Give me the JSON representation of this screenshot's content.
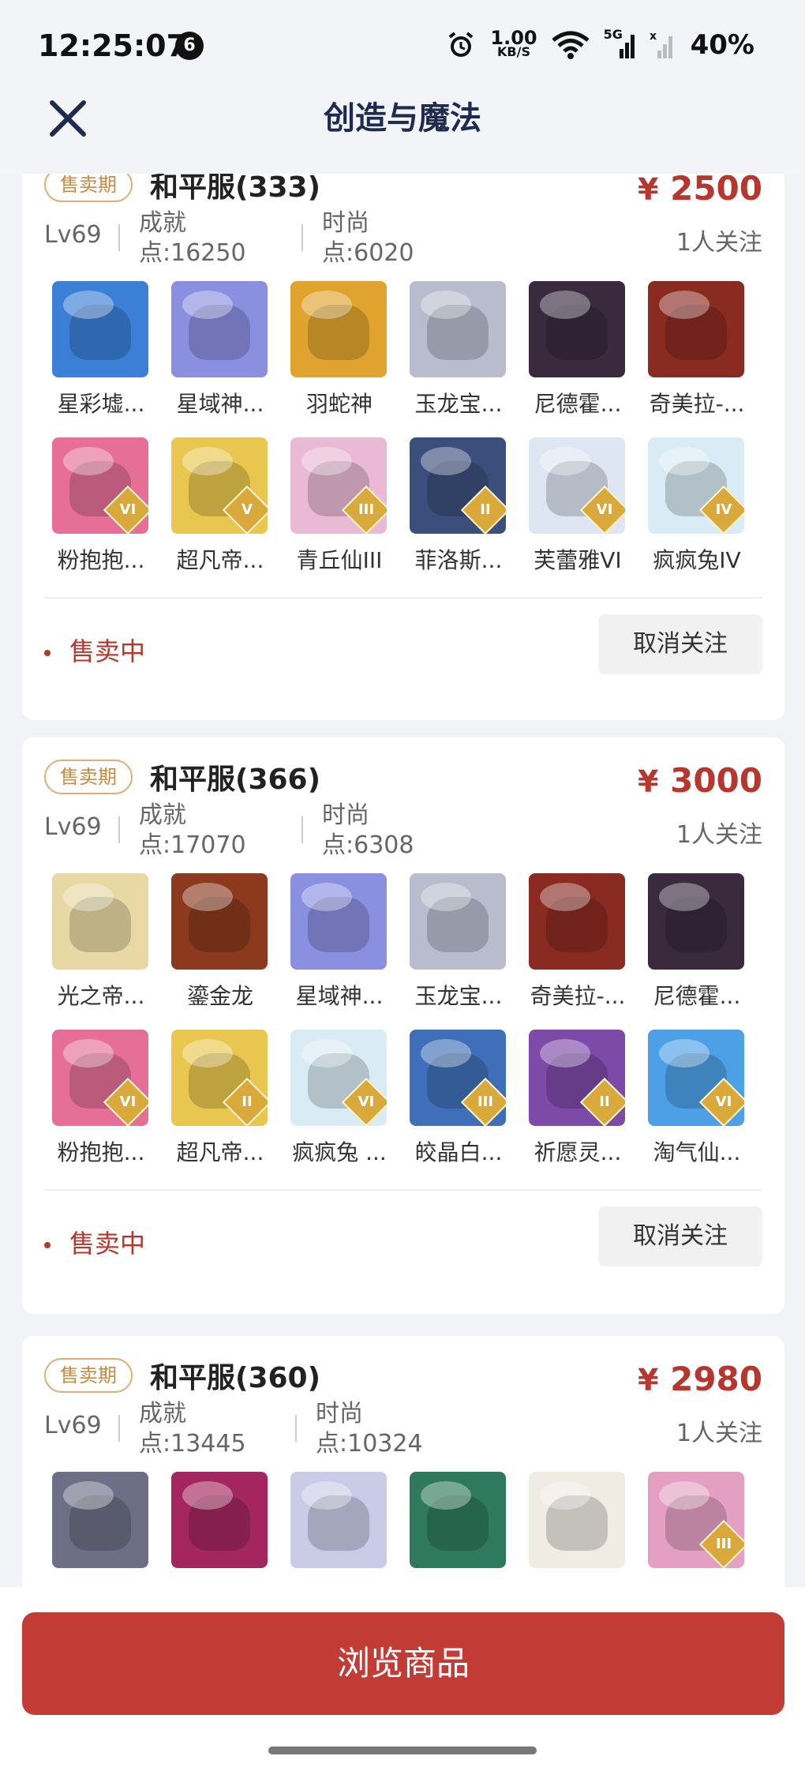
{
  "status_bar": {
    "time": "12:25:07",
    "notification_count": "6",
    "speed_value": "1.00",
    "speed_unit": "KB/S",
    "network": "5G",
    "battery": "40%"
  },
  "nav": {
    "title": "创造与魔法"
  },
  "cards": [
    {
      "tag": "售卖期",
      "server": "和平服(333)",
      "price_symbol": "¥",
      "price": "2500",
      "followers": "1人关注",
      "level": "Lv69",
      "achievement": [
        "成就",
        "点:16250"
      ],
      "fashion": [
        "时尚",
        "点:6020"
      ],
      "items": [
        {
          "name": "星彩墟...",
          "color": "#3b7fd6"
        },
        {
          "name": "星域神...",
          "color": "#8a8fe0"
        },
        {
          "name": "羽蛇神",
          "color": "#e0a42e"
        },
        {
          "name": "玉龙宝...",
          "color": "#b9bccd"
        },
        {
          "name": "尼德霍...",
          "color": "#3a2a3e"
        },
        {
          "name": "奇美拉-...",
          "color": "#8a2b22"
        },
        {
          "name": "粉抱抱...",
          "color": "#e56f97",
          "rank": "VI"
        },
        {
          "name": "超凡帝...",
          "color": "#e9c64f",
          "rank": "V"
        },
        {
          "name": "青丘仙III",
          "color": "#e9b9d6",
          "rank": "III"
        },
        {
          "name": "菲洛斯...",
          "color": "#3c4f7c",
          "rank": "II"
        },
        {
          "name": "芙蕾雅VI",
          "color": "#dfe6f3",
          "rank": "VI"
        },
        {
          "name": "疯疯兔IV",
          "color": "#d9ecf5",
          "rank": "IV"
        }
      ],
      "status": "售卖中",
      "action": "取消关注"
    },
    {
      "tag": "售卖期",
      "server": "和平服(366)",
      "price_symbol": "¥",
      "price": "3000",
      "followers": "1人关注",
      "level": "Lv69",
      "achievement": [
        "成就",
        "点:17070"
      ],
      "fashion": [
        "时尚",
        "点:6308"
      ],
      "items": [
        {
          "name": "光之帝...",
          "color": "#e8d8a3"
        },
        {
          "name": "鎏金龙",
          "color": "#8b3a1e"
        },
        {
          "name": "星域神...",
          "color": "#8a8fe0"
        },
        {
          "name": "玉龙宝...",
          "color": "#b9bccd"
        },
        {
          "name": "奇美拉-...",
          "color": "#8a2b22"
        },
        {
          "name": "尼德霍...",
          "color": "#3a2a3e"
        },
        {
          "name": "粉抱抱...",
          "color": "#e56f97",
          "rank": "VI"
        },
        {
          "name": "超凡帝...",
          "color": "#e9c64f",
          "rank": "II"
        },
        {
          "name": "疯疯兔 ...",
          "color": "#d9ecf5",
          "rank": "VI"
        },
        {
          "name": "皎晶白...",
          "color": "#3f6fb8",
          "rank": "III"
        },
        {
          "name": "祈愿灵...",
          "color": "#7d4aa8",
          "rank": "II"
        },
        {
          "name": "淘气仙...",
          "color": "#4ea0e6",
          "rank": "VI"
        }
      ],
      "status": "售卖中",
      "action": "取消关注"
    },
    {
      "tag": "售卖期",
      "server": "和平服(360)",
      "price_symbol": "¥",
      "price": "2980",
      "followers": "1人关注",
      "level": "Lv69",
      "achievement": [
        "成就",
        "点:13445"
      ],
      "fashion": [
        "时尚",
        "点:10324"
      ],
      "items": [
        {
          "name": "",
          "color": "#6d6f86"
        },
        {
          "name": "",
          "color": "#a3265e"
        },
        {
          "name": "",
          "color": "#c9cbe7"
        },
        {
          "name": "",
          "color": "#2f7a5e"
        },
        {
          "name": "",
          "color": "#f0ece4"
        },
        {
          "name": "",
          "color": "#e4a0c2",
          "rank": "III"
        }
      ],
      "status": "",
      "action": ""
    }
  ],
  "bottom": {
    "button": "浏览商品"
  }
}
